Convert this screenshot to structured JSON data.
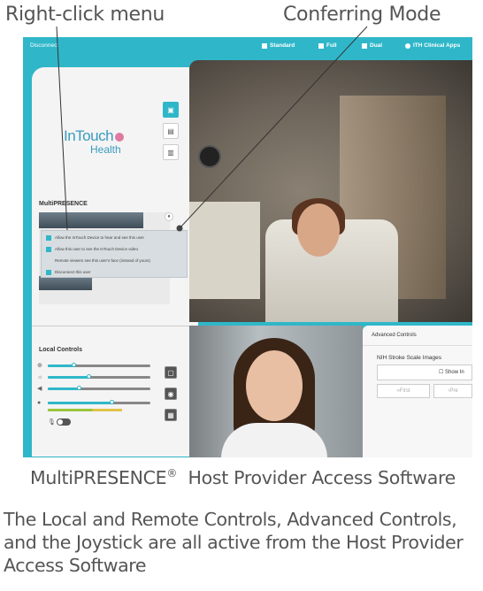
{
  "callouts": {
    "left": "Right-click menu",
    "right": "Conferring Mode"
  },
  "topbar": {
    "disconnect": "Disconnect",
    "modes": [
      "Standard",
      "Full",
      "Dual",
      "ITH Clinical Apps"
    ]
  },
  "logo": {
    "line1": "InTouch",
    "line2": "Health"
  },
  "multipresence": {
    "label": "MultiPRESENCE",
    "menu_items": [
      "Allow the InTouch Device to hear and see this user",
      "Allow this user to see the InTouch Device video",
      "Remote viewers see this user's face (instead of yours)",
      "Disconnect this user"
    ],
    "menu_checked": [
      true,
      true,
      false,
      true
    ]
  },
  "local_controls": {
    "label": "Local Controls",
    "sliders": [
      {
        "icon": "zoom-icon",
        "value": 0.25
      },
      {
        "icon": "brightness-icon",
        "value": 0.4
      },
      {
        "icon": "speaker-icon",
        "value": 0.3
      },
      {
        "icon": "mic-icon",
        "value": 0.62
      }
    ]
  },
  "advanced": {
    "title": "Advanced Controls",
    "subtitle": "NIH Stroke Scale Images",
    "show_label": "Show In",
    "first_label": "First",
    "prev_label": "Pre"
  },
  "caption": {
    "text": "MultiPRESENCE",
    "reg": "®",
    "rest": "Host Provider Access Software"
  },
  "description": "The Local and Remote Controls, Advanced Controls, and the Joystick are all active from the Host Provider Access Software"
}
